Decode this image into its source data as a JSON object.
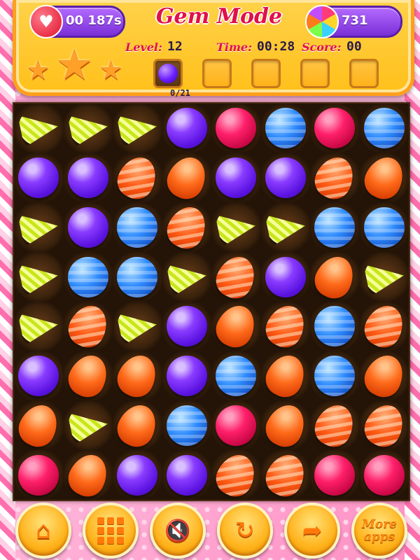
{
  "hud": {
    "title": "Gem Mode",
    "lives_timer": "00 187s",
    "coins": "731",
    "level_label": "Level:",
    "level_value": "12",
    "time_label": "Time:",
    "time_value": "00:28",
    "score_label": "Score:",
    "score_value": "00",
    "goal_progress": "0/21",
    "stars_earned": 0,
    "stars_total": 3
  },
  "board": {
    "rows": 8,
    "cols": 8,
    "grid": [
      [
        "yellow",
        "yellow",
        "yellow",
        "purple",
        "red",
        "blue",
        "red",
        "blue"
      ],
      [
        "purple",
        "purple",
        "ostripe",
        "orange",
        "purple",
        "purple",
        "ostripe",
        "orange"
      ],
      [
        "yellow",
        "purple",
        "blue",
        "ostripe",
        "yellow",
        "yellow",
        "blue",
        "blue"
      ],
      [
        "yellow",
        "blue",
        "blue",
        "yellow",
        "ostripe",
        "purple",
        "orange",
        "yellow"
      ],
      [
        "yellow",
        "ostripe",
        "yellow",
        "purple",
        "orange",
        "ostripe",
        "blue",
        "ostripe"
      ],
      [
        "purple",
        "orange",
        "orange",
        "purple",
        "blue",
        "orange",
        "blue",
        "orange"
      ],
      [
        "orange",
        "yellow",
        "orange",
        "blue",
        "red",
        "orange",
        "ostripe",
        "ostripe"
      ],
      [
        "red",
        "orange",
        "purple",
        "purple",
        "ostripe",
        "ostripe",
        "red",
        "red"
      ]
    ]
  },
  "controls": {
    "home_icon": "home-icon",
    "menu_icon": "grid-menu-icon",
    "sound_icon": "sound-off-icon",
    "restart_icon": "restart-icon",
    "next_icon": "forward-arrow-icon",
    "more_apps_label": "More apps"
  },
  "colors": {
    "hud_bg": "#ffc01a",
    "title": "#e0104a",
    "board_bg": "#241407",
    "pill": "#7a2fd6"
  }
}
